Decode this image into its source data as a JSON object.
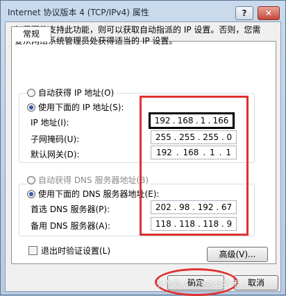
{
  "window": {
    "title": "Internet 协议版本 4 (TCP/IPv4) 属性",
    "help_label": "?",
    "close_label": "✕"
  },
  "tabs": [
    {
      "label": "常规"
    }
  ],
  "description": "如果网络支持此功能，则可以获取自动指派的 IP 设置。否则，您需要从网络系统管理员处获得适当的 IP 设置。",
  "ip_section": {
    "auto_label": "自动获得 IP 地址(O)",
    "manual_label": "使用下面的 IP 地址(S):",
    "selected": "manual",
    "fields": [
      {
        "label": "IP 地址(I):",
        "octets": [
          "192",
          "168",
          "1",
          "166"
        ]
      },
      {
        "label": "子网掩码(U):",
        "octets": [
          "255",
          "255",
          "255",
          "0"
        ]
      },
      {
        "label": "默认网关(D):",
        "octets": [
          "192",
          "168",
          "1",
          "1"
        ]
      }
    ]
  },
  "dns_section": {
    "auto_label": "自动获得 DNS 服务器地址(B)",
    "manual_label": "使用下面的 DNS 服务器地址(E):",
    "selected": "manual",
    "fields": [
      {
        "label": "首选 DNS 服务器(P):",
        "octets": [
          "202",
          "98",
          "192",
          "67"
        ]
      },
      {
        "label": "备用 DNS 服务器(A):",
        "octets": [
          "118",
          "118",
          "118",
          "9"
        ]
      }
    ]
  },
  "validate_on_exit_label": "退出时验证设置(L)",
  "buttons": {
    "advanced": "高级(V)...",
    "ok": "确定",
    "cancel": "取消"
  },
  "watermark": "头条号 / 工作办公技术",
  "colors": {
    "highlight": "#e03030",
    "radio_selected": "#2a5ea8"
  }
}
